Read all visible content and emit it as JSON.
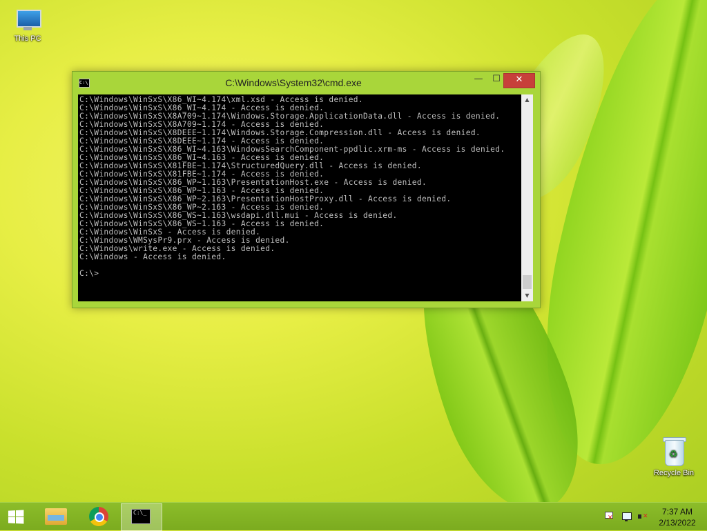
{
  "desktop": {
    "icons": [
      {
        "label": "This PC",
        "icon": "computer-icon"
      },
      {
        "label": "Recycle Bin",
        "icon": "recycle-bin-icon"
      }
    ]
  },
  "window": {
    "title": "C:\\Windows\\System32\\cmd.exe",
    "icon": "cmd-icon",
    "buttons": {
      "minimize": "—",
      "maximize": "☐",
      "close": "✕"
    },
    "console_text": "C:\\Windows\\WinSxS\\X86_WI~4.174\\xml.xsd - Access is denied.\nC:\\Windows\\WinSxS\\X86_WI~4.174 - Access is denied.\nC:\\Windows\\WinSxS\\X8A709~1.174\\Windows.Storage.ApplicationData.dll - Access is denied.\nC:\\Windows\\WinSxS\\X8A709~1.174 - Access is denied.\nC:\\Windows\\WinSxS\\X8DEEE~1.174\\Windows.Storage.Compression.dll - Access is denied.\nC:\\Windows\\WinSxS\\X8DEEE~1.174 - Access is denied.\nC:\\Windows\\WinSxS\\X86_WI~4.163\\WindowsSearchComponent-ppdlic.xrm-ms - Access is denied.\nC:\\Windows\\WinSxS\\X86_WI~4.163 - Access is denied.\nC:\\Windows\\WinSxS\\X81FBE~1.174\\StructuredQuery.dll - Access is denied.\nC:\\Windows\\WinSxS\\X81FBE~1.174 - Access is denied.\nC:\\Windows\\WinSxS\\X86_WP~1.163\\PresentationHost.exe - Access is denied.\nC:\\Windows\\WinSxS\\X86_WP~1.163 - Access is denied.\nC:\\Windows\\WinSxS\\X86_WP~2.163\\PresentationHostProxy.dll - Access is denied.\nC:\\Windows\\WinSxS\\X86_WP~2.163 - Access is denied.\nC:\\Windows\\WinSxS\\X86_WS~1.163\\wsdapi.dll.mui - Access is denied.\nC:\\Windows\\WinSxS\\X86_WS~1.163 - Access is denied.\nC:\\Windows\\WinSxS - Access is denied.\nC:\\Windows\\WMSysPr9.prx - Access is denied.\nC:\\Windows\\write.exe - Access is denied.\nC:\\Windows - Access is denied.\n\nC:\\>"
  },
  "taskbar": {
    "start_icon": "windows-logo-icon",
    "pinned": [
      {
        "name": "file-explorer",
        "icon": "folder-icon"
      },
      {
        "name": "chrome",
        "icon": "chrome-icon"
      },
      {
        "name": "command-prompt",
        "icon": "cmd-icon",
        "active": true
      }
    ],
    "tray_icons": [
      "action-center-flag-icon",
      "network-icon",
      "volume-muted-icon"
    ],
    "time": "7:37 AM",
    "date": "2/13/2022"
  }
}
